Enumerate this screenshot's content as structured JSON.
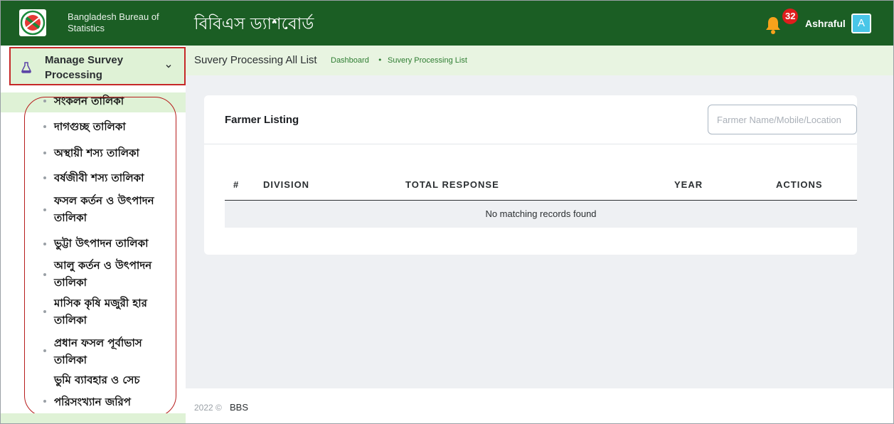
{
  "header": {
    "org_name": "Bangladesh Bureau of Statistics",
    "app_title": "বিবিএস ড্যাশবোর্ড",
    "notification_count": "32",
    "username": "Ashraful",
    "avatar_letter": "A"
  },
  "sidebar": {
    "section_label": "Manage Survey Processing",
    "items": [
      {
        "label": "সংকলন তালিকা",
        "active": true
      },
      {
        "label": "দাগগুচ্ছ তালিকা"
      },
      {
        "label": "অস্থায়ী শস্য তালিকা"
      },
      {
        "label": "বর্ষজীবী শস্য তালিকা"
      },
      {
        "label": "ফসল কর্তন ও উৎপাদন তালিকা"
      },
      {
        "label": "ভুট্টা উৎপাদন তালিকা"
      },
      {
        "label": "আলু কর্তন ও উৎপাদন তালিকা"
      },
      {
        "label": "মাসিক কৃষি মজুরী হার তালিকা"
      },
      {
        "label": "প্রধান ফসল পূর্বাভাস তালিকা"
      },
      {
        "label": "ভুমি ব্যাবহার ও সেচ"
      },
      {
        "label": "পরিসংখ্যান জরিপ"
      }
    ]
  },
  "subheader": {
    "page_title": "Suvery Processing All List",
    "breadcrumb": [
      "Dashboard",
      "Suvery Processing List"
    ]
  },
  "card": {
    "title": "Farmer Listing",
    "search_placeholder": "Farmer Name/Mobile/Location",
    "columns": [
      "#",
      "DIVISION",
      "TOTAL RESPONSE",
      "YEAR",
      "ACTIONS"
    ],
    "empty_message": "No matching records found"
  },
  "footer": {
    "year": "2022 ©",
    "org": "BBS"
  },
  "colors": {
    "topbar": "#1b5e24",
    "sidebar_highlight": "#dff2d6",
    "notification_badge": "#e01d1d",
    "bell": "#f7a21b",
    "avatar": "#49c6e8",
    "annotation_red": "#c62828"
  }
}
